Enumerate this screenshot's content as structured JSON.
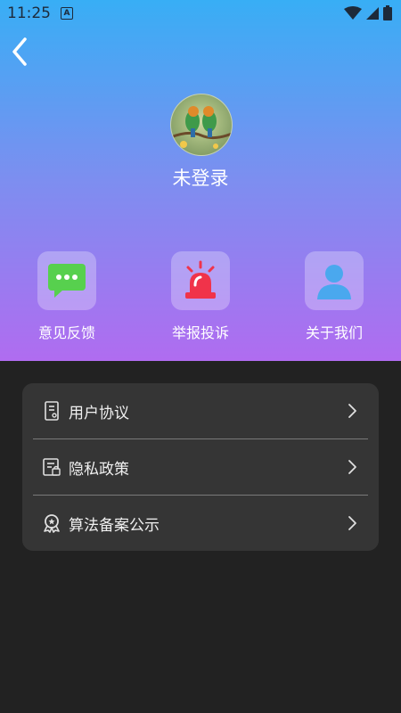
{
  "status_bar": {
    "time": "11:25",
    "notification_icon": "a-icon"
  },
  "header": {
    "back_icon": "back-chevron-icon"
  },
  "profile": {
    "nickname": "未登录"
  },
  "actions": [
    {
      "label": "意见反馈",
      "icon": "chat-bubble-icon"
    },
    {
      "label": "举报投诉",
      "icon": "alarm-siren-icon"
    },
    {
      "label": "关于我们",
      "icon": "person-icon"
    }
  ],
  "menu": [
    {
      "label": "用户协议",
      "icon": "agreement-doc-icon"
    },
    {
      "label": "隐私政策",
      "icon": "privacy-doc-icon"
    },
    {
      "label": "算法备案公示",
      "icon": "award-badge-icon"
    }
  ],
  "colors": {
    "hero_top": "#38aef5",
    "hero_bottom": "#b06cf0",
    "background": "#222222",
    "card": "#353535",
    "chat_green": "#57d04e",
    "siren_red": "#f0334a",
    "person_blue": "#4aa8ee"
  }
}
